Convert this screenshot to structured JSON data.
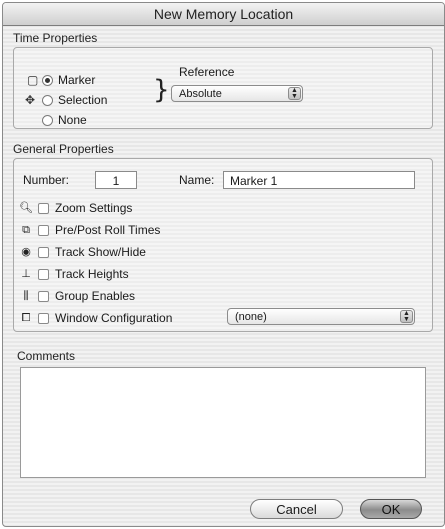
{
  "dialog": {
    "title": "New Memory Location"
  },
  "time_properties": {
    "label": "Time Properties",
    "options": [
      {
        "label": "Marker",
        "icon": "marker-icon",
        "checked": true
      },
      {
        "label": "Selection",
        "icon": "selection-icon",
        "checked": false
      },
      {
        "label": "None",
        "icon": "",
        "checked": false
      }
    ],
    "reference": {
      "label": "Reference",
      "value": "Absolute"
    }
  },
  "general_properties": {
    "label": "General Properties",
    "number_label": "Number:",
    "number_value": "1",
    "name_label": "Name:",
    "name_value": "Marker 1",
    "checkboxes": [
      {
        "label": "Zoom Settings",
        "icon": "magnifier-icon",
        "checked": false
      },
      {
        "label": "Pre/Post Roll Times",
        "icon": "pre-post-roll-icon",
        "checked": false
      },
      {
        "label": "Track Show/Hide",
        "icon": "eye-icon",
        "checked": false
      },
      {
        "label": "Track Heights",
        "icon": "track-height-icon",
        "checked": false
      },
      {
        "label": "Group Enables",
        "icon": "group-icon",
        "checked": false
      },
      {
        "label": "Window Configuration",
        "icon": "window-config-icon",
        "checked": false
      }
    ],
    "window_config_value": "(none)"
  },
  "comments": {
    "label": "Comments",
    "value": ""
  },
  "buttons": {
    "cancel": "Cancel",
    "ok": "OK"
  }
}
